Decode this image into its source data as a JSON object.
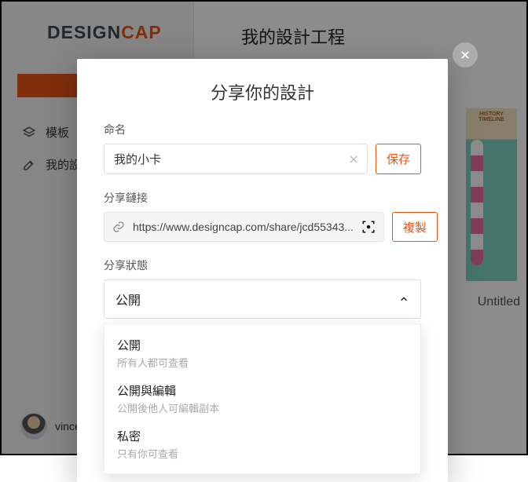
{
  "logo": {
    "part1": "DESIGN",
    "part2": "CAP"
  },
  "nav": {
    "templates": "模板",
    "my_designs": "我的設"
  },
  "page_title": "我的設計工程",
  "thumb": {
    "title": "HISTORY TIMELINE",
    "caption": "Untitled"
  },
  "user": {
    "name": "vincent.t"
  },
  "modal": {
    "title": "分享你的設計",
    "name_label": "命名",
    "name_value": "我的小卡",
    "save": "保存",
    "link_label": "分享鏈接",
    "link_value": "https://www.designcap.com/share/jcd55343...",
    "copy": "複製",
    "state_label": "分享狀態",
    "state_selected": "公開",
    "options": [
      {
        "t": "公開",
        "d": "所有人都可查看"
      },
      {
        "t": "公開與編輯",
        "d": "公開後他人可編輯副本"
      },
      {
        "t": "私密",
        "d": "只有你可查看"
      }
    ]
  }
}
